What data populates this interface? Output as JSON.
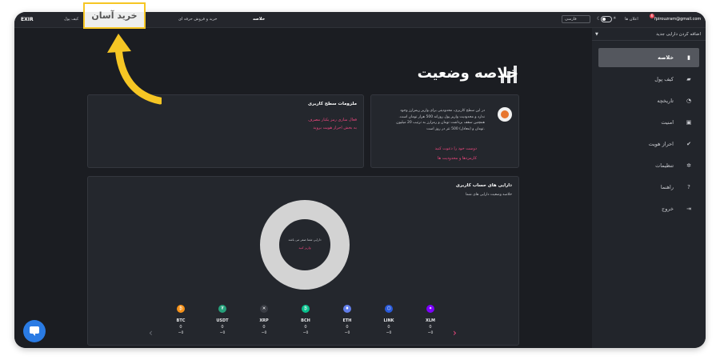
{
  "topbar": {
    "logo": "EXIR",
    "wallet": "کیف پول",
    "trade": "خرید و فروش حرفه ای",
    "summary": "خلاصه",
    "language": "فارسی",
    "notifications": "اعلان ها",
    "notification_count": "6",
    "email": "fpirouzram@gmail.com"
  },
  "callout": {
    "label": "خرید آسان",
    "color": "#f6c624"
  },
  "sidebar": {
    "add_asset": "اضافه کردن دارایی جدید",
    "items": [
      {
        "label": "خلاصه",
        "icon": "bar-chart-icon",
        "active": true
      },
      {
        "label": "کیف پول",
        "icon": "wallet-icon",
        "active": false
      },
      {
        "label": "تاریخچه",
        "icon": "history-icon",
        "active": false
      },
      {
        "label": "امنیت",
        "icon": "lock-icon",
        "active": false
      },
      {
        "label": "احراز هویت",
        "icon": "check-circle-icon",
        "active": false
      },
      {
        "label": "تنظیمات",
        "icon": "gear-icon",
        "active": false
      },
      {
        "label": "راهنما",
        "icon": "help-icon",
        "active": false
      },
      {
        "label": "خروج",
        "icon": "logout-icon",
        "active": false
      }
    ]
  },
  "page": {
    "title": "خلاصه وضعیت"
  },
  "kyc_card": {
    "title": "ملزومات سطح کاربری",
    "item1": "فعال سازی رمز یکبار مصرف",
    "item2": "به بخش احراز هویت بروید"
  },
  "level_card": {
    "description": "در این سطح کاربری، محدودیتی برای واریز ریمزارز وجود ندارد و محدودیت واریز پول روزانه 500 هزار تومان است. همچنین سقف برداشت تومان و رمزارز به ترتیب 20 میلیون تومان و (معادل) 500 تتر در روز است.",
    "invite": "دوست خود را دعوت کنید",
    "limits": "کارمزدها و محدودیت ها"
  },
  "assets_card": {
    "title": "دارایی های حساب کاربری",
    "subtitle": "خلاصه وضعیت دارایی های شما",
    "donut_text": "دارایی شما صفر می باشد",
    "donut_link": "واریز کنید"
  },
  "coins": [
    {
      "symbol": "BTC",
      "balance": "0",
      "value": "~0",
      "color": "#f7931a",
      "icon": "btc-icon",
      "glyph": "₿"
    },
    {
      "symbol": "USDT",
      "balance": "0",
      "value": "~0",
      "color": "#26a17b",
      "icon": "usdt-icon",
      "glyph": "₮"
    },
    {
      "symbol": "XRP",
      "balance": "0",
      "value": "~0",
      "color": "#3a3d44",
      "icon": "xrp-icon",
      "glyph": "✕"
    },
    {
      "symbol": "BCH",
      "balance": "0",
      "value": "~0",
      "color": "#0ac18e",
      "icon": "bch-icon",
      "glyph": "₿"
    },
    {
      "symbol": "ETH",
      "balance": "0",
      "value": "~0",
      "color": "#627eea",
      "icon": "eth-icon",
      "glyph": "♦"
    },
    {
      "symbol": "LINK",
      "balance": "0",
      "value": "~0",
      "color": "#2a5ada",
      "icon": "link-icon",
      "glyph": "⬡"
    },
    {
      "symbol": "XLM",
      "balance": "0",
      "value": "~0",
      "color": "#7d00ff",
      "icon": "xlm-icon",
      "glyph": "✦"
    }
  ]
}
